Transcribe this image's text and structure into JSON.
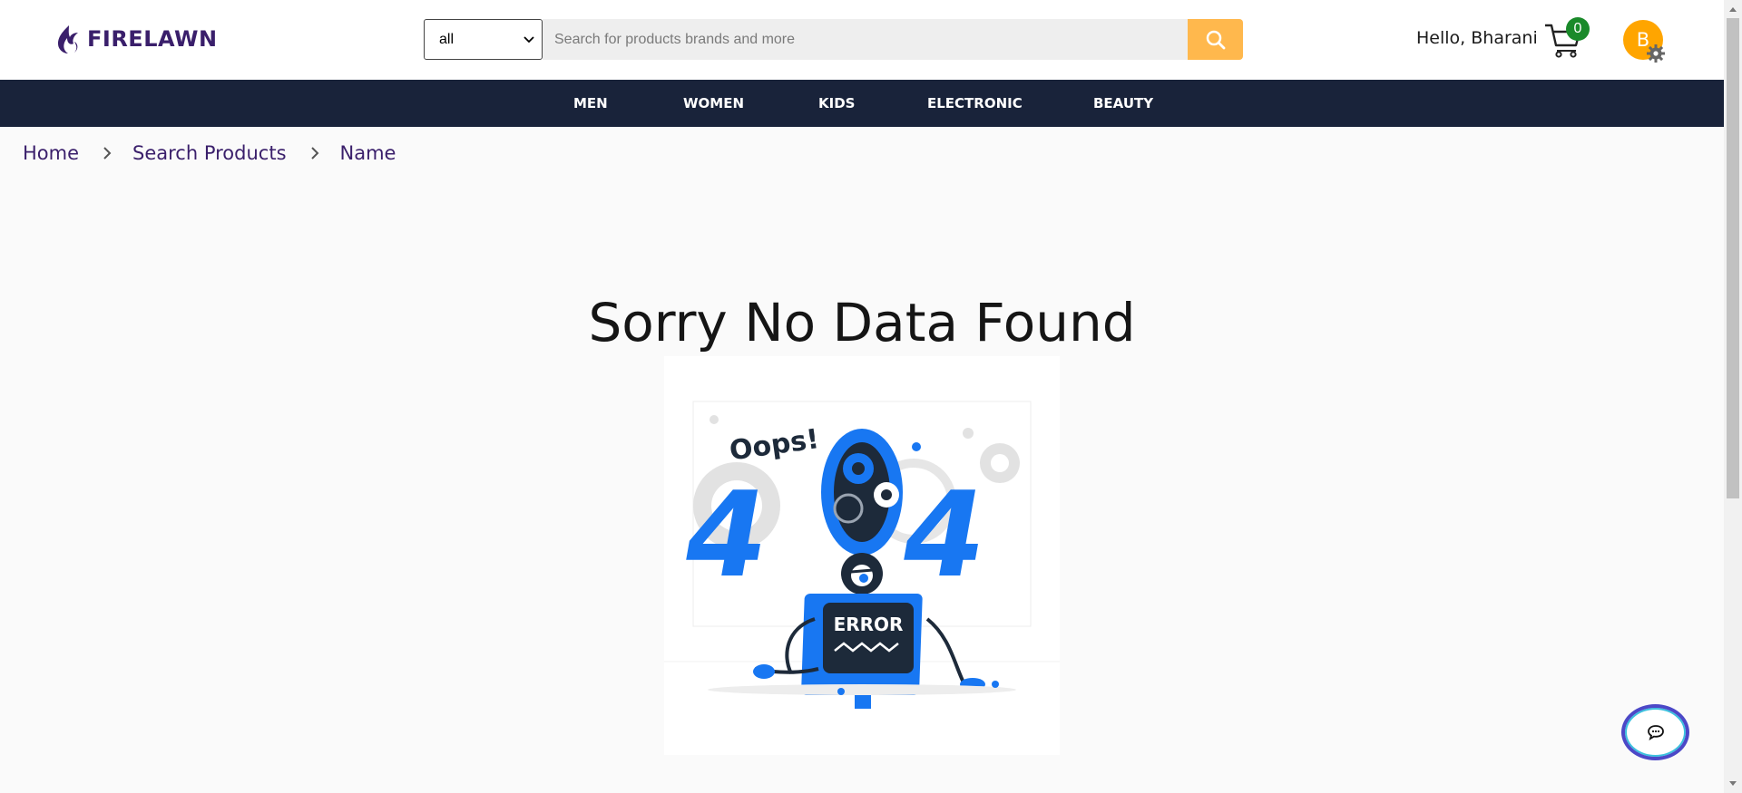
{
  "brand": {
    "name": "FIRELAWN",
    "color": "#3a1f6b"
  },
  "search": {
    "category_selected": "all",
    "placeholder": "Search for products brands and more",
    "value": ""
  },
  "user": {
    "greeting": "Hello, Bharani",
    "avatar_initial": "B",
    "cart_count": "0"
  },
  "nav": {
    "items": [
      {
        "label": "MEN"
      },
      {
        "label": "WOMEN"
      },
      {
        "label": "KIDS"
      },
      {
        "label": "ELECTRONIC"
      },
      {
        "label": "BEAUTY"
      }
    ]
  },
  "breadcrumb": {
    "items": [
      {
        "label": "Home"
      },
      {
        "label": "Search Products"
      },
      {
        "label": "Name"
      }
    ]
  },
  "main": {
    "title": "Sorry No Data Found"
  },
  "illustration": {
    "oops_text": "Oops!",
    "digit_left": "4",
    "digit_right": "4",
    "error_text": "ERROR"
  },
  "colors": {
    "accent": "#ffb84d",
    "nav_bg": "#19233a",
    "avatar": "#ffa500",
    "badge": "#1a8a2a",
    "illustration_blue": "#1877f2"
  }
}
